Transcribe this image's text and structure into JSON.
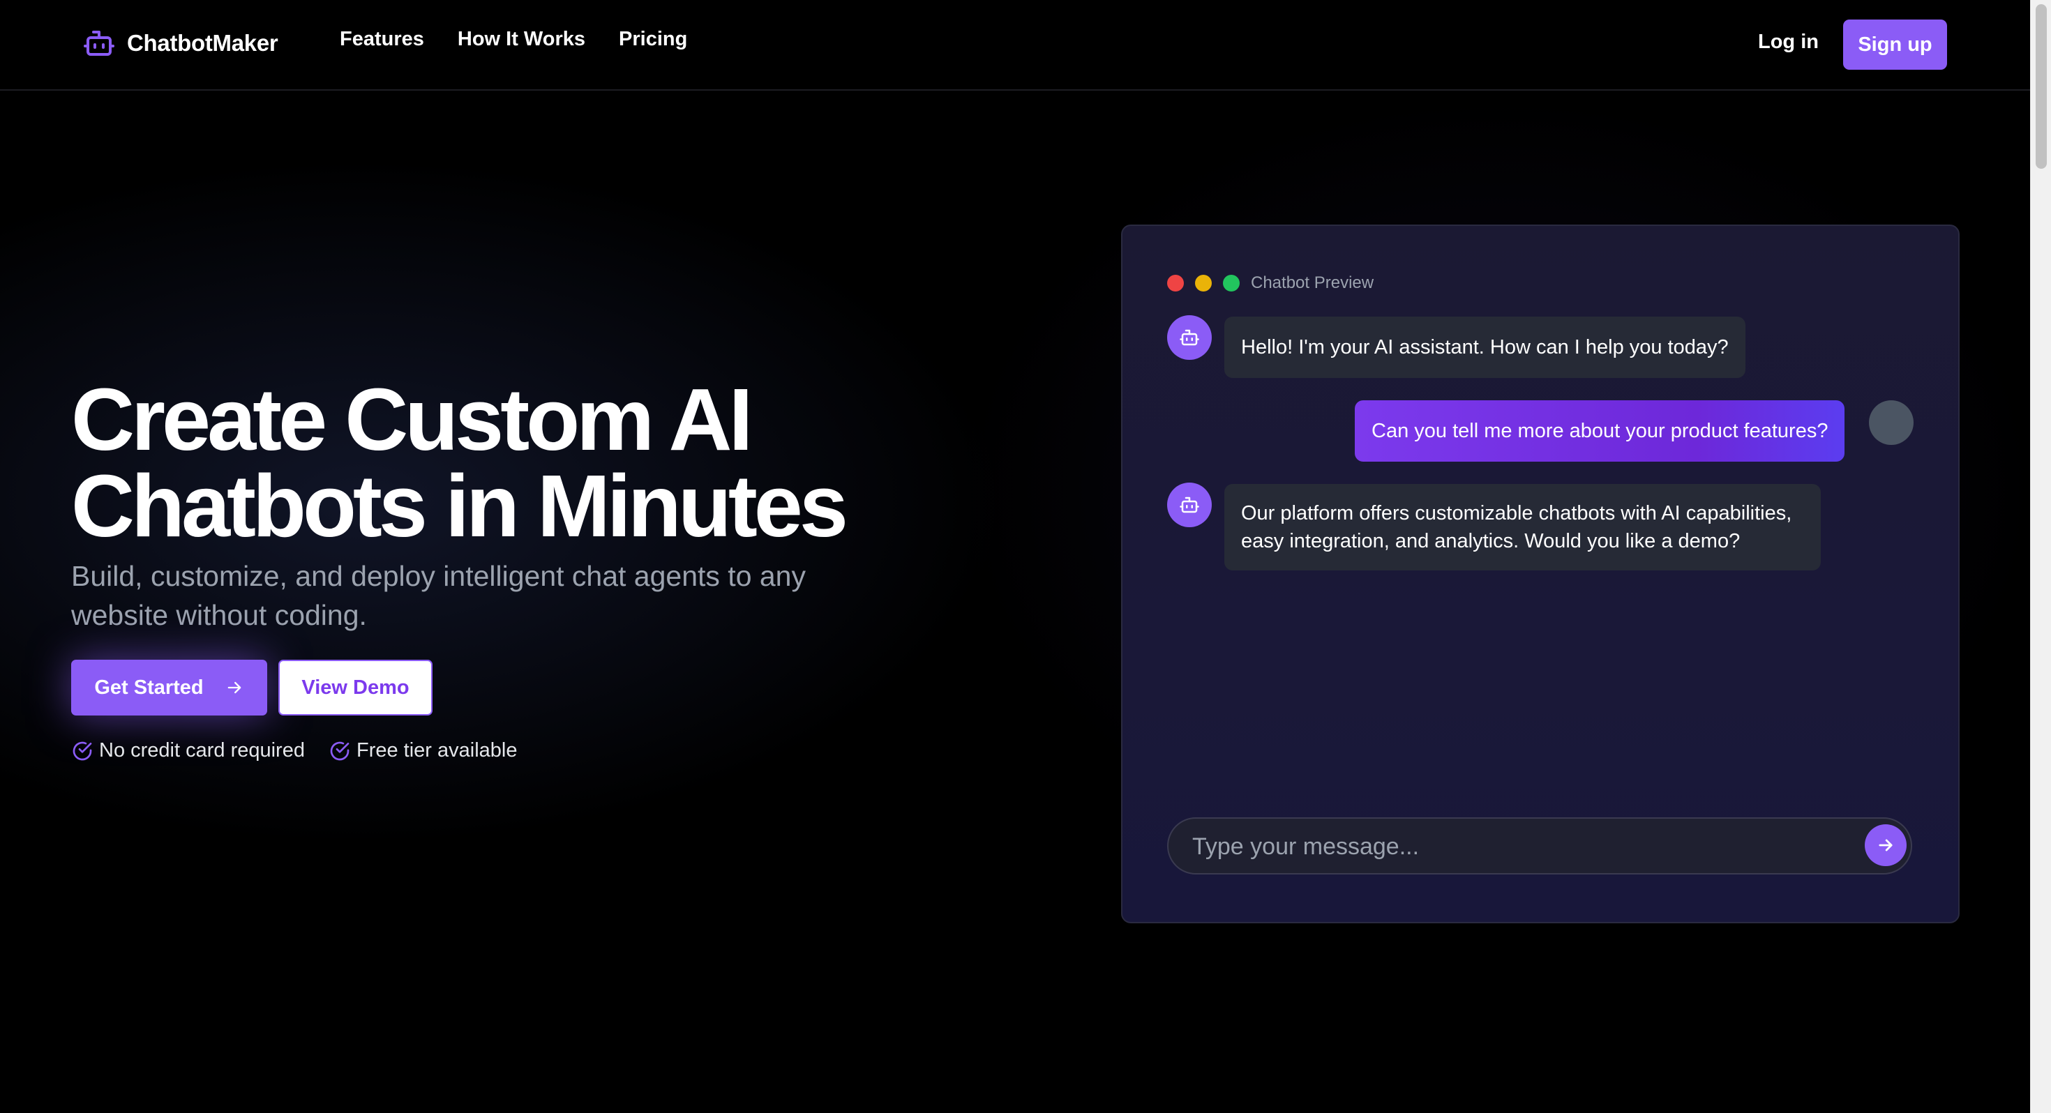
{
  "brand": {
    "name": "ChatbotMaker",
    "logo_icon": "robot-icon",
    "accent": "#8b5cf6"
  },
  "nav": {
    "links": [
      "Features",
      "How It Works",
      "Pricing"
    ],
    "login_label": "Log in",
    "signup_label": "Sign up"
  },
  "hero": {
    "headline_line1": "Create Custom AI",
    "headline_line2": "Chatbots in Minutes",
    "subheadline": "Build, customize, and deploy intelligent chat agents to any website without coding.",
    "primary_cta": "Get Started",
    "primary_cta_icon": "arrow-right-icon",
    "secondary_cta": "View Demo",
    "perks": [
      "No credit card required",
      "Free tier available"
    ],
    "perk_icon": "check-circle-icon"
  },
  "preview": {
    "title": "Chatbot Preview",
    "window_dots": [
      "#ef4444",
      "#eab308",
      "#22c55e"
    ],
    "messages": [
      {
        "role": "bot",
        "text": "Hello! I'm your AI assistant. How can I help you today?"
      },
      {
        "role": "user",
        "text": "Can you tell me more about your product features?"
      },
      {
        "role": "bot",
        "text": "Our platform offers customizable chatbots with AI capabilities, easy integration, and analytics. Would you like a demo?"
      }
    ],
    "input_placeholder": "Type your message...",
    "send_icon": "arrow-right-icon"
  }
}
